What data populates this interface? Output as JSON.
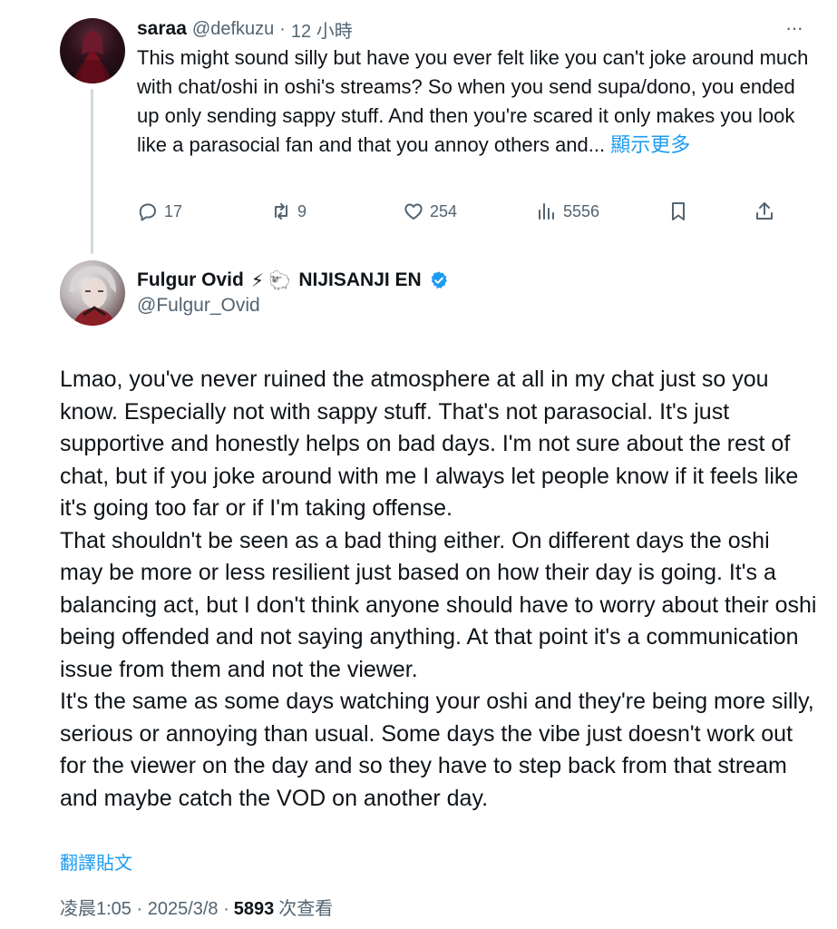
{
  "reply": {
    "display_name": "saraa",
    "handle": "@defkuzu",
    "separator": "·",
    "time": "12 小時",
    "text": "This might sound silly but have you ever felt like you can't joke around much with chat/oshi in oshi's streams? So when you send supa/dono, you ended up only sending sappy stuff. And then you're scared it only makes you look like a parasocial fan and that you annoy others and...",
    "show_more": "顯示更多",
    "more_menu": "···",
    "stats": {
      "replies": "17",
      "reposts": "9",
      "likes": "254",
      "views": "5556"
    }
  },
  "main": {
    "display_name": "Fulgur Ovid",
    "name_emoji": "⚡ 🐑",
    "affiliation": "NIJISANJI EN",
    "handle": "@Fulgur_Ovid",
    "paragraphs": [
      "Lmao, you've never ruined the atmosphere at all in my chat just so you know. Especially not with sappy stuff. That's not parasocial. It's just supportive and honestly helps on bad days. I'm not sure about the rest of chat, but if you joke around with me I always let people know if it feels like it's going too far or if I'm taking offense.",
      "That shouldn't be seen as a bad thing either. On different days the oshi may be more or less resilient just based on how their day is going. It's a balancing act, but I don't think anyone should have to worry about their oshi being offended and not saying anything. At that point it's a communication issue from them and not the viewer.",
      "It's the same as some days watching your oshi and they're being more silly, serious or annoying than usual. Some days the vibe just doesn't work out for the viewer on the day and so they have to step back from that stream and maybe catch the VOD on another day."
    ],
    "translate_label": "翻譯貼文",
    "timestamp": "凌晨1:05 · 2025/3/8 ·",
    "view_count": "5893",
    "views_suffix": "次查看"
  },
  "colors": {
    "text": "#0f1419",
    "muted": "#536471",
    "link": "#1d9bf0",
    "verified": "#1d9bf0",
    "thread_line": "#cfd9de"
  }
}
